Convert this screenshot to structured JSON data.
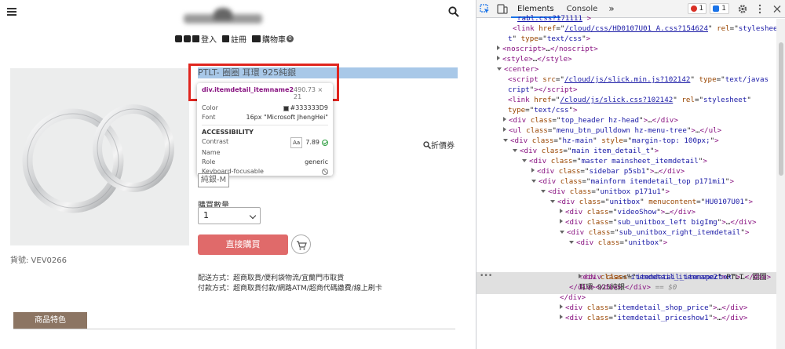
{
  "page": {
    "topnav": {
      "login": "登入",
      "register": "註冊",
      "cart": "購物車",
      "cart_count": "0"
    },
    "product": {
      "title": "PTLT- 圈圈 耳環 925純銀",
      "sku": "貨號: VEV0266",
      "spec_option": "純銀-M",
      "coupon": "折價券",
      "qty_label": "購買數量",
      "qty_value": "1",
      "buy_button": "直接購買",
      "shipping": "配送方式：超商取貨/便利袋物流/宜蘭門市取貨",
      "payment": "付款方式：超商取貨付款/網路ATM/超商代碼繳費/線上刷卡",
      "features_tab": "商品特色"
    },
    "tooltip": {
      "selector": "div.itemdetail_itemname2",
      "dimensions": "490.73 × 21",
      "color_label": "Color",
      "color_value": "#333333D9",
      "font_label": "Font",
      "font_value": "16px \"Microsoft JhengHei\"",
      "section": "ACCESSIBILITY",
      "contrast_label": "Contrast",
      "contrast_aa": "Aa",
      "contrast_value": "7.89",
      "name_label": "Name",
      "role_label": "Role",
      "role_value": "generic",
      "keyboard_label": "Keyboard-focusable"
    }
  },
  "devtools": {
    "tabs": [
      "Elements",
      "Console"
    ],
    "active_tab": "Elements",
    "more": "»",
    "errors": "1",
    "messages": "1",
    "lines": [
      {
        "t": "top",
        "html": "<span class='link'>rabl.css?171111</span> <span class='tag'>&gt;</span>"
      },
      {
        "t": "",
        "html": "<span class='tag'>&lt;link</span> <span class='attr'>href</span>=\"<span class='link'>/cloud/css/HD0107U01_A.css?154624</span>\" <span class='attr'>rel</span>=\"<span class='val'>styleshee</span>"
      },
      {
        "t": "",
        "html": "<span class='val'>t</span>\" <span class='attr'>type</span>=\"<span class='val'>text/css</span>\"<span class='tag'>&gt;</span>"
      },
      {
        "t": "r",
        "html": "<span class='tag'>&lt;noscript&gt;</span>…<span class='tag'>&lt;/noscript&gt;</span>"
      },
      {
        "t": "r",
        "html": "<span class='tag'>&lt;style&gt;</span>…<span class='tag'>&lt;/style&gt;</span>"
      },
      {
        "t": "d",
        "html": "<span class='tag'>&lt;center&gt;</span>"
      },
      {
        "t": "",
        "html": "<span class='tag'>&lt;script</span> <span class='attr'>src</span>=\"<span class='link'>/cloud/js/slick.min.js?102142</span>\" <span class='attr'>type</span>=\"<span class='val'>text/javas</span>"
      },
      {
        "t": "",
        "html": "<span class='val'>cript</span>\"<span class='tag'>&gt;&lt;/script&gt;</span>"
      },
      {
        "t": "",
        "html": "<span class='tag'>&lt;link</span> <span class='attr'>href</span>=\"<span class='link'>/cloud/js/slick.css?102142</span>\" <span class='attr'>rel</span>=\"<span class='val'>stylesheet</span>\""
      },
      {
        "t": "",
        "html": "<span class='attr'>type</span>=\"<span class='val'>text/css</span>\"<span class='tag'>&gt;</span>"
      },
      {
        "t": "r",
        "html": "<span class='tag'>&lt;div</span> <span class='attr'>class</span>=\"<span class='val'>top_header hz-head</span>\"<span class='tag'>&gt;</span>…<span class='tag'>&lt;/div&gt;</span>"
      },
      {
        "t": "r",
        "html": "<span class='tag'>&lt;ul</span> <span class='attr'>class</span>=\"<span class='val'>menu_btn_pulldown hz-menu-tree</span>\"<span class='tag'>&gt;</span>…<span class='tag'>&lt;/ul&gt;</span>"
      },
      {
        "t": "d",
        "html": "<span class='tag'>&lt;div</span> <span class='attr'>class</span>=\"<span class='val'>hz-main</span>\" <span class='attr'>style</span>=\"<span class='val'>margin-top: 100px;</span>\"<span class='tag'>&gt;</span>"
      },
      {
        "t": "d",
        "html": "<span class='tag'>&lt;div</span> <span class='attr'>class</span>=\"<span class='val'>main item_detail_t</span>\"<span class='tag'>&gt;</span>"
      },
      {
        "t": "d",
        "html": "<span class='tag'>&lt;div</span> <span class='attr'>class</span>=\"<span class='val'>master mainsheet_itemdetail</span>\"<span class='tag'>&gt;</span>"
      },
      {
        "t": "r",
        "html": "<span class='tag'>&lt;div</span> <span class='attr'>class</span>=\"<span class='val'>sidebar p5sb1</span>\"<span class='tag'>&gt;</span>…<span class='tag'>&lt;/div&gt;</span>"
      },
      {
        "t": "d",
        "html": "<span class='tag'>&lt;div</span> <span class='attr'>class</span>=\"<span class='val'>mainform itemdetail_top p171mi1</span>\"<span class='tag'>&gt;</span>"
      },
      {
        "t": "d",
        "html": "<span class='tag'>&lt;div</span> <span class='attr'>class</span>=\"<span class='val'>unitbox p171u1</span>\"<span class='tag'>&gt;</span>"
      },
      {
        "t": "d",
        "html": "<span class='tag'>&lt;div</span> <span class='attr'>class</span>=\"<span class='val'>unitbox</span>\" <span class='attr'>menucontent</span>=\"<span class='val'>HU0107U01</span>\"<span class='tag'>&gt;</span>"
      },
      {
        "t": "r",
        "html": "<span class='tag'>&lt;div</span> <span class='attr'>class</span>=\"<span class='val'>videoShow</span>\"<span class='tag'>&gt;</span>…<span class='tag'>&lt;/div&gt;</span>"
      },
      {
        "t": "r",
        "html": "<span class='tag'>&lt;div</span> <span class='attr'>class</span>=\"<span class='val'>sub_unitbox_left bigImg</span>\"<span class='tag'>&gt;</span>…<span class='tag'>&lt;/div&gt;</span>"
      },
      {
        "t": "d",
        "html": "<span class='tag'>&lt;div</span> <span class='attr'>class</span>=\"<span class='val'>sub_unitbox_right_itemdetail</span>\"<span class='tag'>&gt;</span>"
      },
      {
        "t": "d",
        "html": "<span class='tag'>&lt;div</span> <span class='attr'>class</span>=\"<span class='val'>unitbox</span>\"<span class='tag'>&gt;</span>"
      },
      {
        "t": "sel1",
        "html": "<span class='tag'>&lt;div</span> <span class='attr'>class</span>=\"<span class='val'>itemdetail_itemname2</span>\"<span class='tag'>&gt;</span><span class='txt'>PTLT- 圈圈</span>"
      },
      {
        "t": "sel2",
        "html": "<span class='txt'>耳環 925純銀</span><span class='tag'>&lt;/div&gt;</span> <span class='dim'>== $0</span>"
      },
      {
        "t": "r",
        "html": "<span class='tag'>&lt;div</span> <span class='attr'>class</span>=\"<span class='val'>itemdetail_itemspecbox</span>\"<span class='tag'>&gt;</span>…<span class='tag'>&lt;/div&gt;</span>"
      },
      {
        "t": "",
        "html": "<span class='tag'>&lt;/div&gt;&lt;/div&gt;</span>"
      },
      {
        "t": "",
        "html": "<span class='tag'>&lt;/div&gt;</span>"
      },
      {
        "t": "r",
        "html": "<span class='tag'>&lt;div</span> <span class='attr'>class</span>=\"<span class='val'>itemdetail_shop_price</span>\"<span class='tag'>&gt;</span>…<span class='tag'>&lt;/div&gt;</span>"
      },
      {
        "t": "r",
        "html": "<span class='tag'>&lt;div</span> <span class='attr'>class</span>=\"<span class='val'>itemdetail_priceshow1</span>\"<span class='tag'>&gt;</span>…<span class='tag'>&lt;/div&gt;</span>"
      }
    ]
  }
}
